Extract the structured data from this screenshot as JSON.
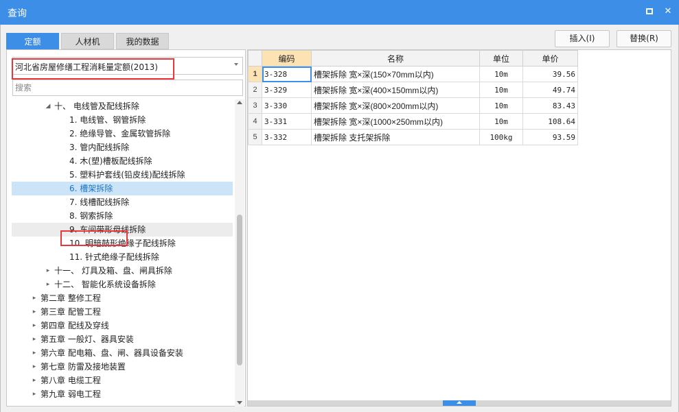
{
  "window": {
    "title": "查询",
    "max_icon": "maximize-icon",
    "close_icon": "close-icon",
    "close_glyph": "✕"
  },
  "tabs": [
    {
      "label": "定额",
      "active": true
    },
    {
      "label": "人材机",
      "active": false
    },
    {
      "label": "我的数据",
      "active": false
    }
  ],
  "actions": {
    "insert_label": "插入(I)",
    "replace_label": "替换(R)"
  },
  "library_select": {
    "value": "河北省房屋修缮工程消耗量定额(2013)"
  },
  "search": {
    "placeholder": "搜索"
  },
  "tree": {
    "items": [
      {
        "label": "十、 电线管及配线拆除",
        "arrow": "◢",
        "state": ""
      },
      {
        "label": "1. 电线管、钢管拆除",
        "arrow": "",
        "state": ""
      },
      {
        "label": "2. 绝缘导管、金属软管拆除",
        "arrow": "",
        "state": ""
      },
      {
        "label": "3. 管内配线拆除",
        "arrow": "",
        "state": ""
      },
      {
        "label": "4. 木(塑)槽板配线拆除",
        "arrow": "",
        "state": ""
      },
      {
        "label": "5. 塑料护套线(铅皮线)配线拆除",
        "arrow": "",
        "state": ""
      },
      {
        "label": "6. 槽架拆除",
        "arrow": "",
        "state": "selected"
      },
      {
        "label": "7. 线槽配线拆除",
        "arrow": "",
        "state": ""
      },
      {
        "label": "8. 钢索拆除",
        "arrow": "",
        "state": ""
      },
      {
        "label": "9. 车间带形母线拆除",
        "arrow": "",
        "state": "hover"
      },
      {
        "label": "10. 明暗鼓形绝缘子配线拆除",
        "arrow": "",
        "state": ""
      },
      {
        "label": "11. 针式绝缘子配线拆除",
        "arrow": "",
        "state": ""
      },
      {
        "label": "十一、 灯具及箱、盘、闸具拆除",
        "arrow": "▸",
        "state": ""
      },
      {
        "label": "十二、 智能化系统设备拆除",
        "arrow": "▸",
        "state": ""
      },
      {
        "label": "第二章 整修工程",
        "arrow": "▸",
        "state": ""
      },
      {
        "label": "第三章 配管工程",
        "arrow": "▸",
        "state": ""
      },
      {
        "label": "第四章 配线及穿线",
        "arrow": "▸",
        "state": ""
      },
      {
        "label": "第五章 一般灯、器具安装",
        "arrow": "▸",
        "state": ""
      },
      {
        "label": "第六章 配电箱、盘、闸、器具设备安装",
        "arrow": "▸",
        "state": ""
      },
      {
        "label": "第七章 防雷及接地装置",
        "arrow": "▸",
        "state": ""
      },
      {
        "label": "第八章 电缆工程",
        "arrow": "▸",
        "state": ""
      },
      {
        "label": "第九章 弱电工程",
        "arrow": "▸",
        "state": ""
      }
    ]
  },
  "grid": {
    "headers": {
      "code": "编码",
      "name": "名称",
      "unit": "单位",
      "price": "单价"
    },
    "rows": [
      {
        "rn": "1",
        "code": "3-328",
        "name": "槽架拆除 宽×深(150×70mm以内)",
        "unit": "10m",
        "price": "39.56"
      },
      {
        "rn": "2",
        "code": "3-329",
        "name": "槽架拆除 宽×深(400×150mm以内)",
        "unit": "10m",
        "price": "49.74"
      },
      {
        "rn": "3",
        "code": "3-330",
        "name": "槽架拆除 宽×深(800×200mm以内)",
        "unit": "10m",
        "price": "83.43"
      },
      {
        "rn": "4",
        "code": "3-331",
        "name": "槽架拆除 宽×深(1000×250mm以内)",
        "unit": "10m",
        "price": "108.64"
      },
      {
        "rn": "5",
        "code": "3-332",
        "name": "槽架拆除 支托架拆除",
        "unit": "100kg",
        "price": "93.59"
      }
    ]
  },
  "colors": {
    "accent": "#3d8ee6",
    "highlight_box": "#e8373a",
    "selected_row": "#cce4f7",
    "header_sorted": "#fde3b3"
  }
}
